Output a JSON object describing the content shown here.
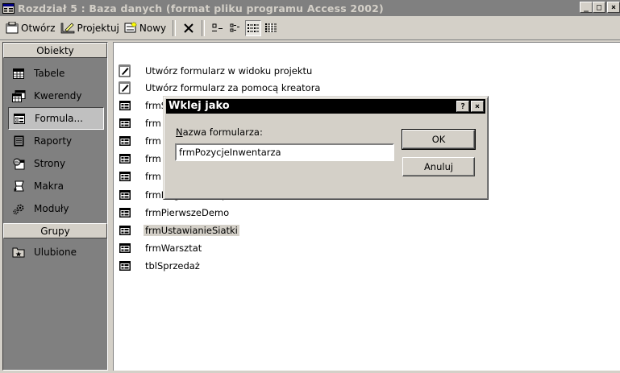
{
  "window": {
    "title": "Rozdział 5 : Baza danych (format pliku programu Access 2002)",
    "min": "_",
    "max": "□",
    "close": "×"
  },
  "toolbar": {
    "open_label": "Otwórz",
    "design_label": "Projektuj",
    "new_label": "Nowy"
  },
  "sidebar": {
    "objects_header": "Obiekty",
    "groups_header": "Grupy",
    "items": [
      {
        "label": "Tabele",
        "icon": "table-icon"
      },
      {
        "label": "Kwerendy",
        "icon": "query-icon"
      },
      {
        "label": "Formula...",
        "icon": "form-icon"
      },
      {
        "label": "Raporty",
        "icon": "report-icon"
      },
      {
        "label": "Strony",
        "icon": "page-icon"
      },
      {
        "label": "Makra",
        "icon": "macro-icon"
      },
      {
        "label": "Moduły",
        "icon": "module-icon"
      }
    ],
    "groups": [
      {
        "label": "Ulubione",
        "icon": "favorites-icon"
      }
    ]
  },
  "list": {
    "items": [
      "Utwórz formularz w widoku projektu",
      "Utwórz formularz za pomocą kreatora",
      "frmS",
      "frm",
      "frm",
      "frm",
      "frm",
      "frmNagłówekStopka",
      "frmPierwszeDemo",
      "frmUstawianieSiatki",
      "frmWarsztat",
      "tblSprzedaż"
    ]
  },
  "dialog": {
    "title": "Wklej jako",
    "help": "?",
    "close": "×",
    "label": "Nazwa formularza:",
    "value": "frmPozycjeInwentarza",
    "ok": "OK",
    "cancel": "Anuluj"
  }
}
